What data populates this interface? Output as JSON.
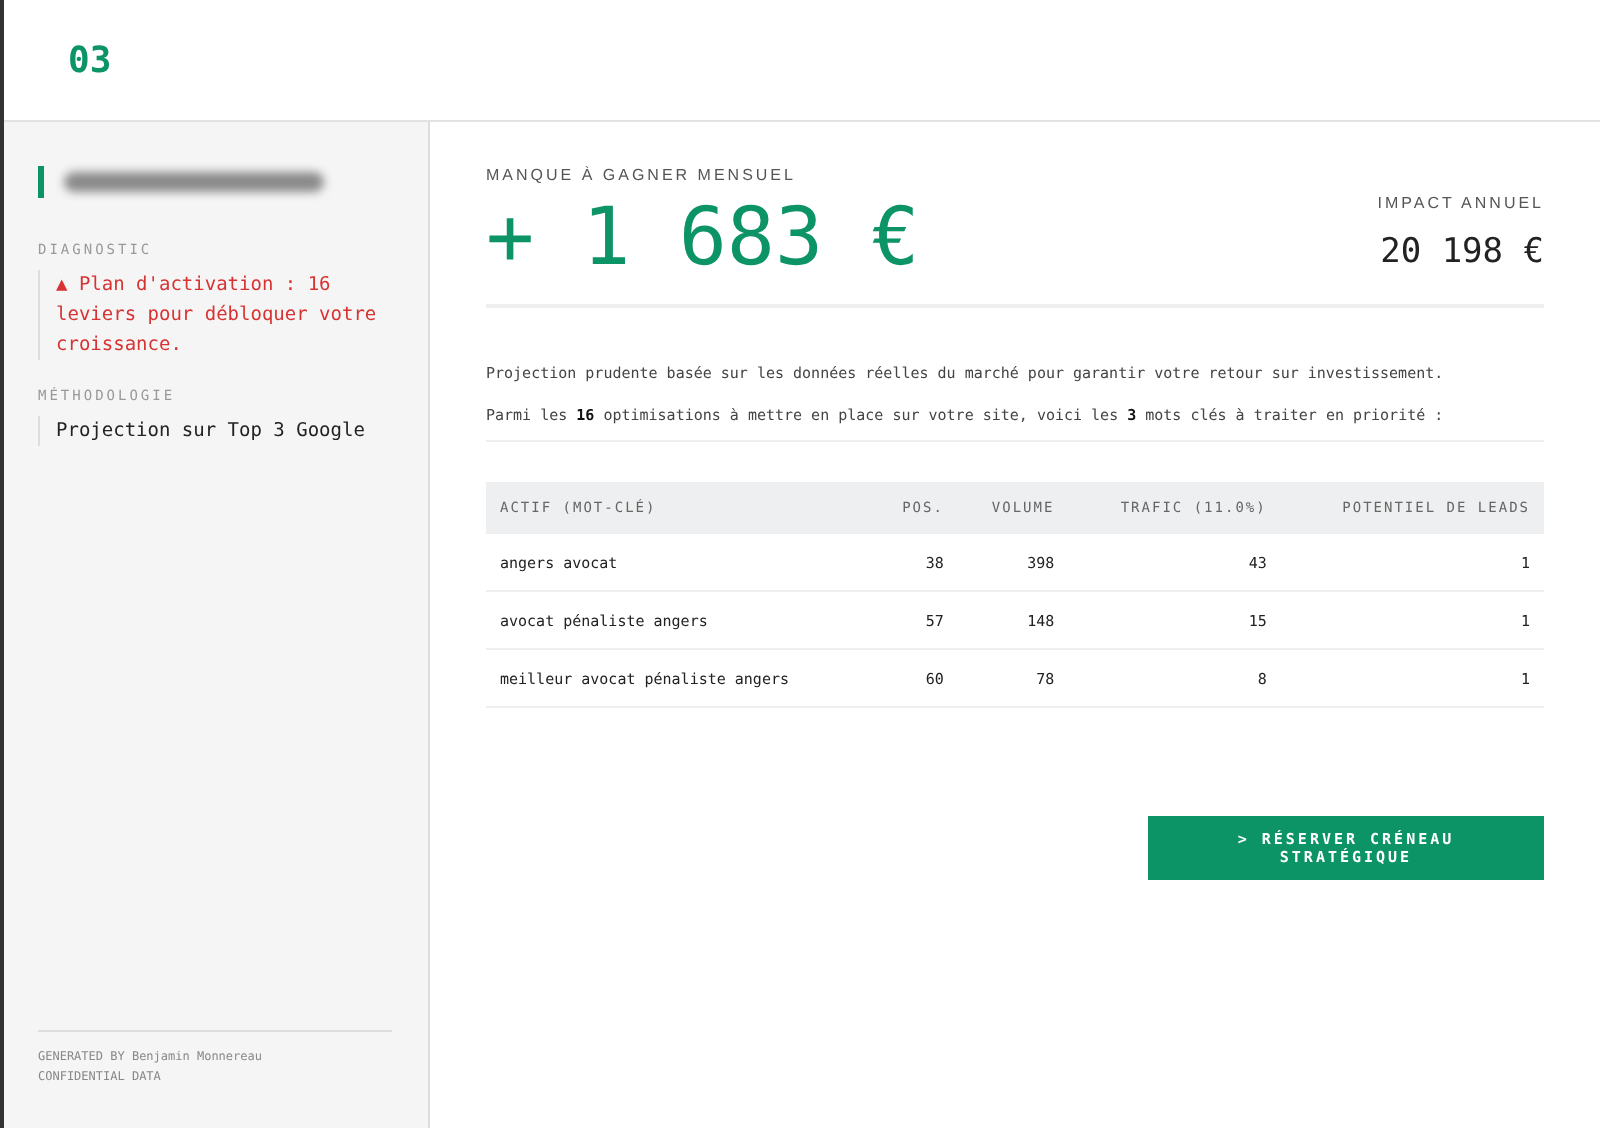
{
  "header": {
    "step": "03"
  },
  "sidebar": {
    "sections": [
      {
        "label": "DIAGNOSTIC",
        "text": "▲ Plan d'activation : 16 leviers pour débloquer votre croissance.",
        "kind": "alert"
      },
      {
        "label": "MÉTHODOLOGIE",
        "text": "Projection sur Top 3 Google",
        "kind": "note"
      }
    ],
    "footer": [
      "GENERATED BY Benjamin Monnereau",
      "CONFIDENTIAL DATA"
    ]
  },
  "summary": {
    "monthly_label": "MANQUE À GAGNER MENSUEL",
    "monthly_value": "+ 1 683 €",
    "annual_label": "IMPACT ANNUEL",
    "annual_value": "20 198 €"
  },
  "paragraphs": [
    "Projection prudente basée sur les données réelles du marché pour garantir votre retour sur investissement.",
    "Parmi les **16** optimisations à mettre en place sur votre site, voici les **3** mots clés à traiter en priorité :"
  ],
  "table": {
    "columns": [
      "ACTIF (MOT-CLÉ)",
      "POS.",
      "VOLUME",
      "TRAFIC (11.0%)",
      "POTENTIEL DE LEADS"
    ],
    "rows": [
      [
        "angers avocat",
        "38",
        "398",
        "43",
        "1"
      ],
      [
        "avocat pénaliste angers",
        "57",
        "148",
        "15",
        "1"
      ],
      [
        "meilleur avocat pénaliste angers",
        "60",
        "78",
        "8",
        "1"
      ]
    ]
  },
  "cta": {
    "label": "> RÉSERVER CRÉNEAU STRATÉGIQUE"
  }
}
